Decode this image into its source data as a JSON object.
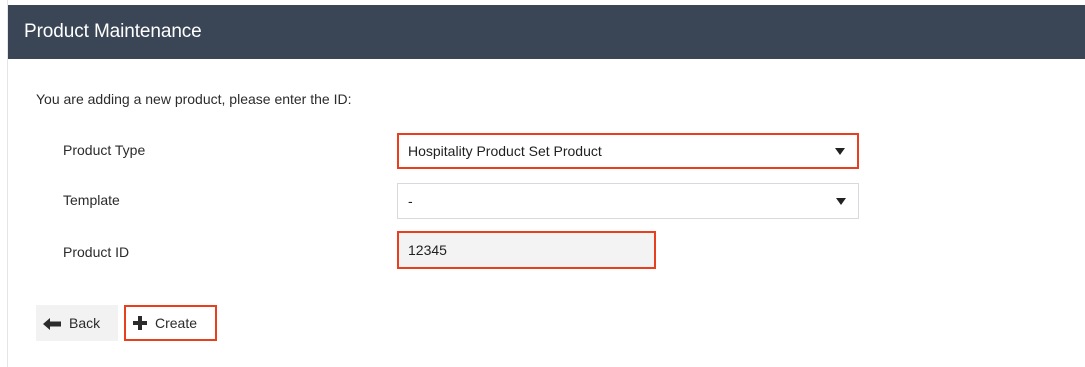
{
  "header": {
    "title": "Product Maintenance"
  },
  "form": {
    "intro": "You are adding a new product, please enter the ID:",
    "product_type": {
      "label": "Product Type",
      "value": "Hospitality Product Set Product"
    },
    "template": {
      "label": "Template",
      "value": "-"
    },
    "product_id": {
      "label": "Product ID",
      "value": "12345"
    }
  },
  "actions": {
    "back_label": "Back",
    "create_label": "Create"
  },
  "colors": {
    "header_bg": "#3a4656",
    "highlight": "#e8401f"
  },
  "icons": {
    "back": "arrow-left-icon",
    "create": "plus-icon",
    "dropdown": "caret-down-icon"
  }
}
